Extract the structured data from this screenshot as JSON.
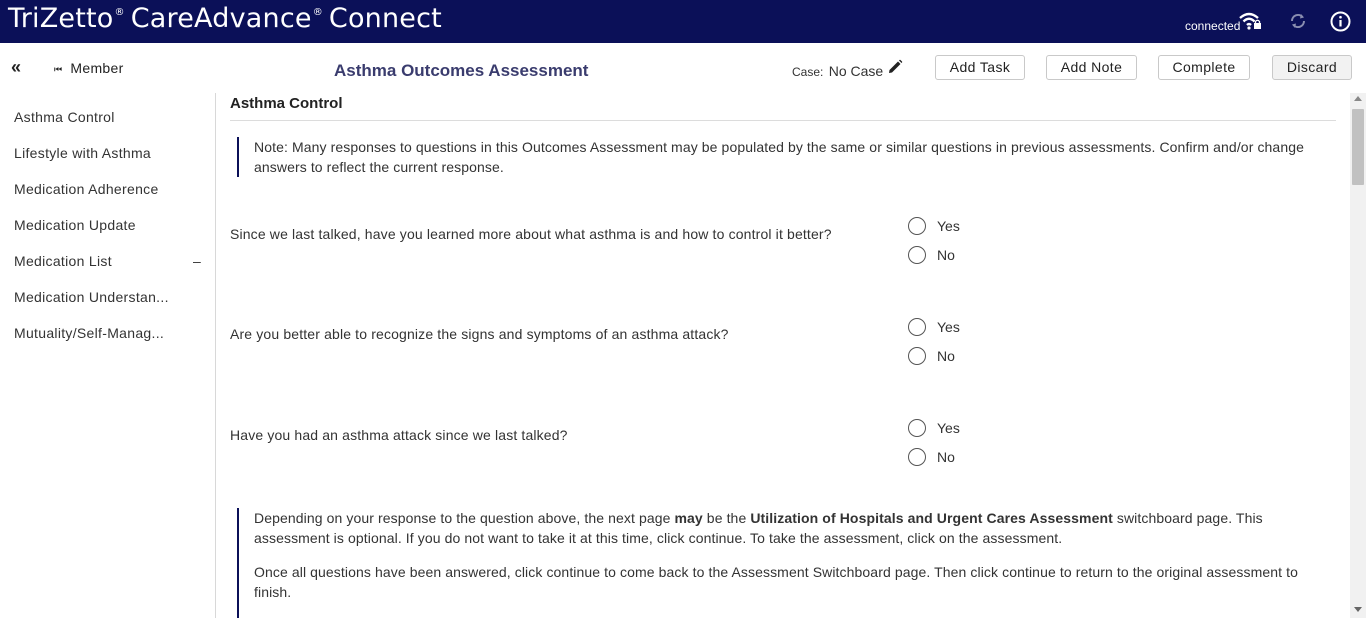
{
  "app": {
    "brand_prefix": "TriZetto",
    "brand_suffix": "CareAdvance",
    "brand_tail": "Connect",
    "trademark": "®",
    "connection_status": "connected",
    "bar_color": "#0b1058"
  },
  "icons": {
    "collapse": "double-chevron-left-icon",
    "member": "skip-back-icon",
    "edit": "pencil-icon",
    "wifi": "wifi-lock-icon",
    "sync": "sync-icon",
    "info": "info-icon"
  },
  "header": {
    "collapse_glyph": "«",
    "member_label": "Member",
    "page_title": "Asthma Outcomes Assessment",
    "case_label": "Case:",
    "case_value": "No Case",
    "buttons": {
      "add_task": "Add Task",
      "add_note": "Add Note",
      "complete": "Complete",
      "discard": "Discard"
    }
  },
  "sidebar": {
    "items": [
      {
        "label": "Asthma Control"
      },
      {
        "label": "Lifestyle with Asthma"
      },
      {
        "label": "Medication Adherence"
      },
      {
        "label": "Medication Update"
      },
      {
        "label": "Medication List"
      },
      {
        "label": "Medication Understan..."
      },
      {
        "label": "Mutuality/Self-Manag..."
      }
    ],
    "expand_marker": "–"
  },
  "main": {
    "section_title": "Asthma Control",
    "note_top": "Note: Many responses to questions in this Outcomes Assessment may be populated by the same or similar questions in previous assessments. Confirm and/or change answers to reflect the current response.",
    "questions": [
      {
        "text": "Since we last talked, have you learned more about what asthma is and how to control it better?",
        "options": [
          "Yes",
          "No"
        ]
      },
      {
        "text": "Are you better able to recognize the signs and symptoms of an asthma attack?",
        "options": [
          "Yes",
          "No"
        ]
      },
      {
        "text": "Have you had an asthma attack since we last talked?",
        "options": [
          "Yes",
          "No"
        ]
      }
    ],
    "note_bottom": {
      "p1_start": "Depending on your response to the question above, the next page ",
      "p1_bold1": "may",
      "p1_mid": " be the ",
      "p1_bold2": "Utilization of Hospitals and Urgent Cares Assessment",
      "p1_end": " switchboard page. This assessment is optional. If you do not want to take it at this time, click continue. To take the assessment, click on the assessment.",
      "p2": "Once all questions have been answered, click continue to come back to the Assessment Switchboard page. Then click continue to return to the original assessment to finish."
    }
  }
}
